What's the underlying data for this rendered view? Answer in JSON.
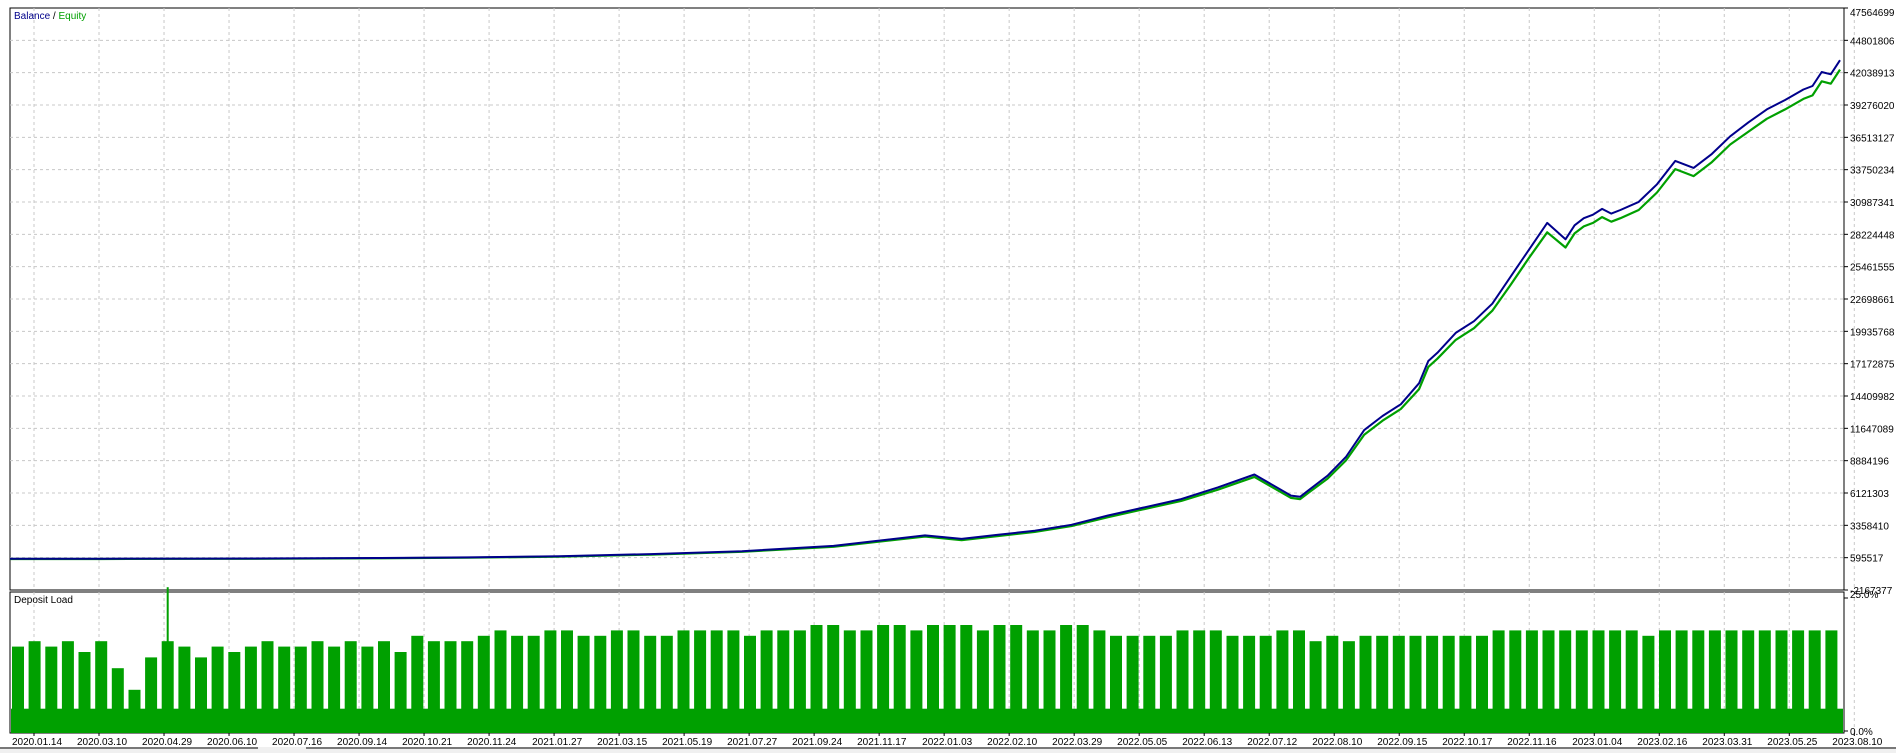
{
  "chart_data": [
    {
      "type": "line",
      "legend": [
        {
          "name": "Balance",
          "color": "#00008b"
        },
        {
          "name": "Equity",
          "color": "#00a000"
        }
      ],
      "legend_separator": " / ",
      "ylim": [
        -2167377,
        47564699
      ],
      "yticks": [
        "47564699",
        "44801806",
        "42038913",
        "39276020",
        "36513127",
        "33750234",
        "30987341",
        "28224448",
        "25461555",
        "22698661",
        "19935768",
        "17172875",
        "14409982",
        "11647089",
        "8884196",
        "6121303",
        "3358410",
        "595517",
        "-2167377"
      ],
      "xlim": [
        0,
        1
      ],
      "grid": true,
      "series": [
        {
          "name": "Balance",
          "x": [
            0.0,
            0.05,
            0.1,
            0.15,
            0.2,
            0.25,
            0.3,
            0.35,
            0.4,
            0.45,
            0.5,
            0.52,
            0.54,
            0.56,
            0.58,
            0.6,
            0.62,
            0.64,
            0.66,
            0.68,
            0.7,
            0.705,
            0.71,
            0.72,
            0.73,
            0.74,
            0.75,
            0.76,
            0.77,
            0.775,
            0.78,
            0.79,
            0.8,
            0.81,
            0.82,
            0.83,
            0.84,
            0.85,
            0.855,
            0.86,
            0.865,
            0.87,
            0.875,
            0.88,
            0.89,
            0.9,
            0.91,
            0.92,
            0.93,
            0.94,
            0.95,
            0.96,
            0.97,
            0.98,
            0.985,
            0.99,
            0.995,
            1.0
          ],
          "values": [
            500000,
            505000,
            515000,
            530000,
            570000,
            620000,
            720000,
            900000,
            1150000,
            1600000,
            2500000,
            2200000,
            2550000,
            2900000,
            3400000,
            4200000,
            4900000,
            5600000,
            6600000,
            7700000,
            5900000,
            5800000,
            6400000,
            7600000,
            9200000,
            11500000,
            12700000,
            13700000,
            15500000,
            17400000,
            18100000,
            19800000,
            20800000,
            22300000,
            24600000,
            26900000,
            29200000,
            27800000,
            29000000,
            29600000,
            29900000,
            30400000,
            30000000,
            30300000,
            31000000,
            32500000,
            34500000,
            33900000,
            35100000,
            36600000,
            37800000,
            38900000,
            39700000,
            40600000,
            40900000,
            42100000,
            41900000,
            43100000
          ]
        },
        {
          "name": "Equity",
          "x": [
            0.0,
            0.05,
            0.1,
            0.15,
            0.2,
            0.25,
            0.3,
            0.35,
            0.4,
            0.45,
            0.5,
            0.52,
            0.54,
            0.56,
            0.58,
            0.6,
            0.62,
            0.64,
            0.66,
            0.68,
            0.7,
            0.705,
            0.71,
            0.72,
            0.73,
            0.74,
            0.75,
            0.76,
            0.77,
            0.775,
            0.78,
            0.79,
            0.8,
            0.81,
            0.82,
            0.83,
            0.84,
            0.85,
            0.855,
            0.86,
            0.865,
            0.87,
            0.875,
            0.88,
            0.89,
            0.9,
            0.91,
            0.92,
            0.93,
            0.94,
            0.95,
            0.96,
            0.97,
            0.98,
            0.985,
            0.99,
            0.995,
            1.0
          ],
          "values": [
            480000,
            485000,
            495000,
            505000,
            540000,
            590000,
            690000,
            860000,
            1100000,
            1520000,
            2400000,
            2100000,
            2450000,
            2800000,
            3300000,
            4050000,
            4750000,
            5450000,
            6400000,
            7500000,
            5700000,
            5600000,
            6200000,
            7350000,
            8900000,
            11100000,
            12300000,
            13300000,
            15000000,
            16900000,
            17600000,
            19200000,
            20200000,
            21700000,
            23900000,
            26200000,
            28400000,
            27100000,
            28300000,
            28900000,
            29200000,
            29700000,
            29300000,
            29600000,
            30300000,
            31800000,
            33800000,
            33200000,
            34400000,
            35900000,
            37000000,
            38100000,
            38900000,
            39800000,
            40100000,
            41300000,
            41100000,
            42300000
          ]
        }
      ]
    },
    {
      "type": "bar",
      "title": "Deposit Load",
      "ylim": [
        0,
        25
      ],
      "yticks": [
        "25.0%",
        "0.0%"
      ],
      "xticks": [
        "2020.01.14",
        "2020.03.10",
        "2020.04.29",
        "2020.06.10",
        "2020.07.16",
        "2020.09.14",
        "2020.10.21",
        "2020.11.24",
        "2021.01.27",
        "2021.03.15",
        "2021.05.19",
        "2021.07.27",
        "2021.09.24",
        "2021.11.17",
        "2022.01.03",
        "2022.02.10",
        "2022.03.29",
        "2022.05.05",
        "2022.06.13",
        "2022.07.12",
        "2022.08.10",
        "2022.09.15",
        "2022.10.17",
        "2022.11.16",
        "2023.01.04",
        "2023.02.16",
        "2023.03.31",
        "2023.05.25",
        "2023.08.10"
      ],
      "color": "#00a000",
      "values": [
        16,
        17,
        16,
        17,
        15,
        17,
        12,
        8,
        14,
        17,
        16,
        14,
        16,
        15,
        16,
        17,
        16,
        16,
        17,
        16,
        17,
        16,
        17,
        15,
        18,
        17,
        17,
        17,
        18,
        19,
        18,
        18,
        19,
        19,
        18,
        18,
        19,
        19,
        18,
        18,
        19,
        19,
        19,
        19,
        18,
        19,
        19,
        19,
        20,
        20,
        19,
        19,
        20,
        20,
        19,
        20,
        20,
        20,
        19,
        20,
        20,
        19,
        19,
        20,
        20,
        19,
        18,
        18,
        18,
        18,
        19,
        19,
        19,
        18,
        18,
        18,
        19,
        19,
        17,
        18,
        17,
        18,
        18,
        18,
        18,
        18,
        18,
        18,
        18,
        19,
        19,
        19,
        19,
        19,
        19,
        19,
        19,
        19,
        18,
        19,
        19,
        19,
        19,
        19,
        19,
        19,
        19,
        19,
        19,
        19
      ],
      "spike": {
        "index": 9,
        "value": 27
      }
    }
  ]
}
